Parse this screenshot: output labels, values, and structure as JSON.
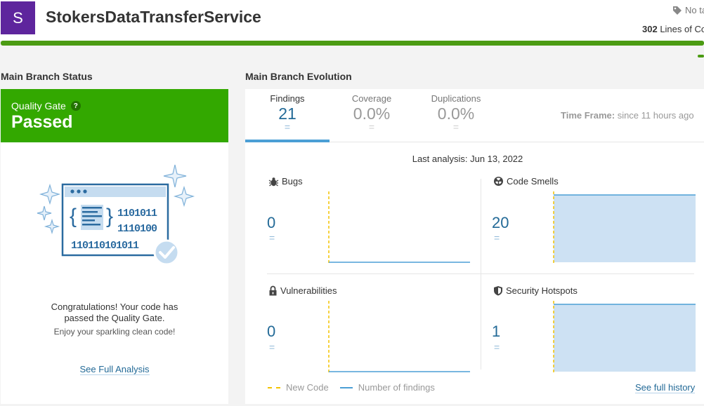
{
  "project": {
    "avatar_letter": "S",
    "name": "StokersDataTransferService",
    "tags_text": "No ta",
    "loc_count": "302",
    "loc_label": " Lines of Co",
    "brand_color": "#5e259d"
  },
  "status": {
    "section_title": "Main Branch Status",
    "quality_gate_label": "Quality Gate",
    "help_label": "?",
    "quality_gate_status": "Passed",
    "status_color": "#33a800",
    "congrats_line1": "Congratulations! Your code has",
    "congrats_line2": "passed the Quality Gate.",
    "enjoy": "Enjoy your sparkling clean code!",
    "see_full_analysis": "See Full Analysis"
  },
  "evolution": {
    "section_title": "Main Branch Evolution",
    "tabs": [
      {
        "label": "Findings",
        "value": "21",
        "eq": "="
      },
      {
        "label": "Coverage",
        "value": "0.0%",
        "eq": "="
      },
      {
        "label": "Duplications",
        "value": "0.0%",
        "eq": "="
      }
    ],
    "time_frame_label": "Time Frame:",
    "time_frame_value": " since 11 hours ago",
    "last_analysis": "Last analysis: Jun 13, 2022",
    "metrics": [
      {
        "title": "Bugs",
        "value": "0",
        "eq": "=",
        "icon": "bug-icon"
      },
      {
        "title": "Code Smells",
        "value": "20",
        "eq": "=",
        "icon": "code-smell-icon"
      },
      {
        "title": "Vulnerabilities",
        "value": "0",
        "eq": "=",
        "icon": "lock-icon"
      },
      {
        "title": "Security Hotspots",
        "value": "1",
        "eq": "=",
        "icon": "shield-icon"
      }
    ],
    "legend_new_code": "New Code",
    "legend_findings": "Number of findings",
    "see_full_history": "See full history",
    "colors": {
      "new_code": "#f4c300",
      "findings_line": "#4b9fd5",
      "findings_area": "#cde1f3"
    }
  }
}
